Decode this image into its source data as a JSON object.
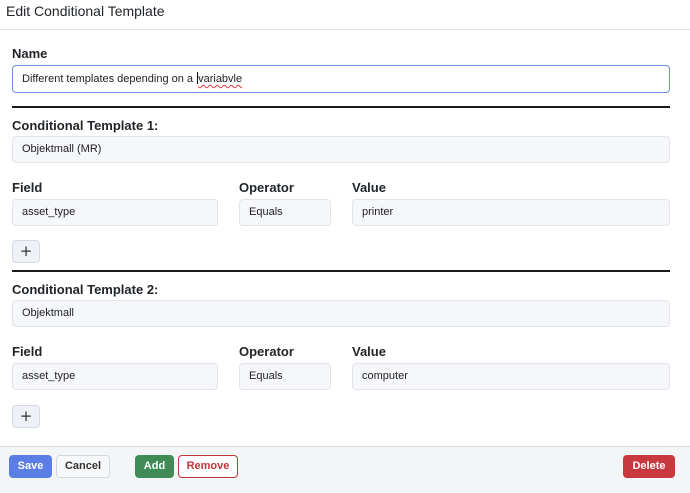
{
  "header": {
    "title": "Edit Conditional Template"
  },
  "name": {
    "label": "Name",
    "value_prefix": "Different templates depending on a ",
    "value_misspelled": "variabvle"
  },
  "conditions": [
    {
      "heading": "Conditional Template 1:",
      "template": "Objektmall (MR)",
      "field_label": "Field",
      "operator_label": "Operator",
      "value_label": "Value",
      "field": "asset_type",
      "operator": "Equals",
      "value": "printer",
      "add_symbol": "+"
    },
    {
      "heading": "Conditional Template 2:",
      "template": "Objektmall",
      "field_label": "Field",
      "operator_label": "Operator",
      "value_label": "Value",
      "field": "asset_type",
      "operator": "Equals",
      "value": "computer",
      "add_symbol": "+"
    }
  ],
  "footer": {
    "save": "Save",
    "cancel": "Cancel",
    "add": "Add",
    "remove": "Remove",
    "delete": "Delete"
  }
}
